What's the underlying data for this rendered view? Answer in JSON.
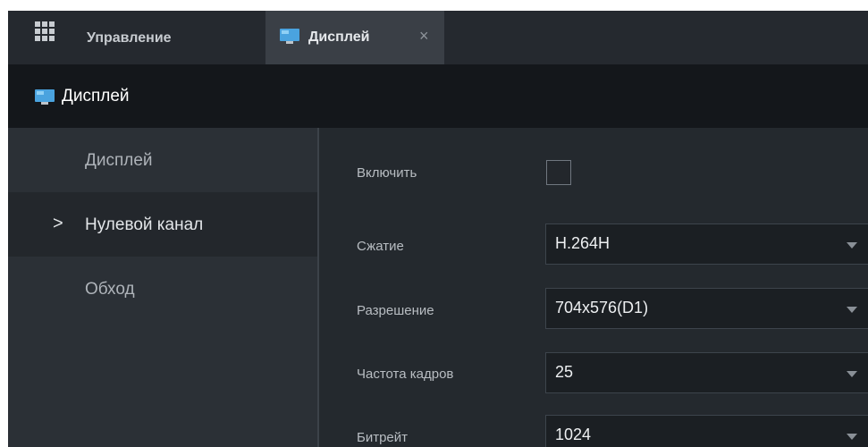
{
  "tabs": {
    "manage_label": "Управление",
    "display_label": "Дисплей",
    "close_glyph": "×"
  },
  "header": {
    "title": "Дисплей"
  },
  "sidebar": {
    "arrow": ">",
    "items": [
      {
        "label": "Дисплей",
        "active": false
      },
      {
        "label": "Нулевой канал",
        "active": true
      },
      {
        "label": "Обход",
        "active": false
      }
    ]
  },
  "form": {
    "enable": {
      "label": "Включить",
      "checked": false
    },
    "compression": {
      "label": "Сжатие",
      "value": "H.264H"
    },
    "resolution": {
      "label": "Разрешение",
      "value": "704x576(D1)"
    },
    "framerate": {
      "label": "Частота кадров",
      "value": "25"
    },
    "bitrate": {
      "label": "Битрейт",
      "value": "1024"
    }
  },
  "colors": {
    "background": "#1f2329",
    "active_tab": "#3a3f46",
    "monitor_icon": "#4aa3df"
  },
  "icons": [
    "grid-icon",
    "monitor-icon",
    "close-icon",
    "chevron-right-icon",
    "caret-down-icon"
  ]
}
